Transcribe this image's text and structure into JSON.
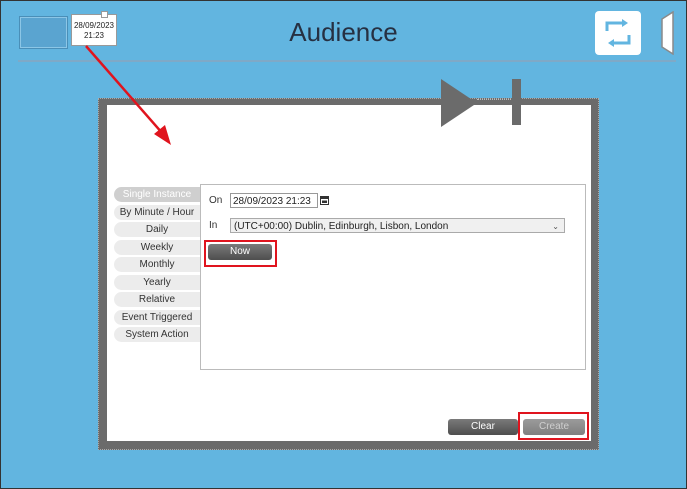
{
  "header": {
    "thumb_date": "28/09/2023",
    "thumb_time": "21:23",
    "title": "Audience"
  },
  "tabs": [
    {
      "label": "Single Instance",
      "active": true
    },
    {
      "label": "By Minute / Hour"
    },
    {
      "label": "Daily"
    },
    {
      "label": "Weekly"
    },
    {
      "label": "Monthly"
    },
    {
      "label": "Yearly"
    },
    {
      "label": "Relative"
    },
    {
      "label": "Event Triggered"
    },
    {
      "label": "System Action"
    }
  ],
  "form": {
    "on_label": "On",
    "on_value": "28/09/2023 21:23",
    "in_label": "In",
    "timezone": "(UTC+00:00) Dublin, Edinburgh, Lisbon, London",
    "now_label": "Now"
  },
  "footer": {
    "clear_label": "Clear",
    "create_label": "Create"
  },
  "colors": {
    "background": "#62b5e0",
    "highlight": "#e0141e",
    "dialog_border": "#6b6b6b"
  }
}
